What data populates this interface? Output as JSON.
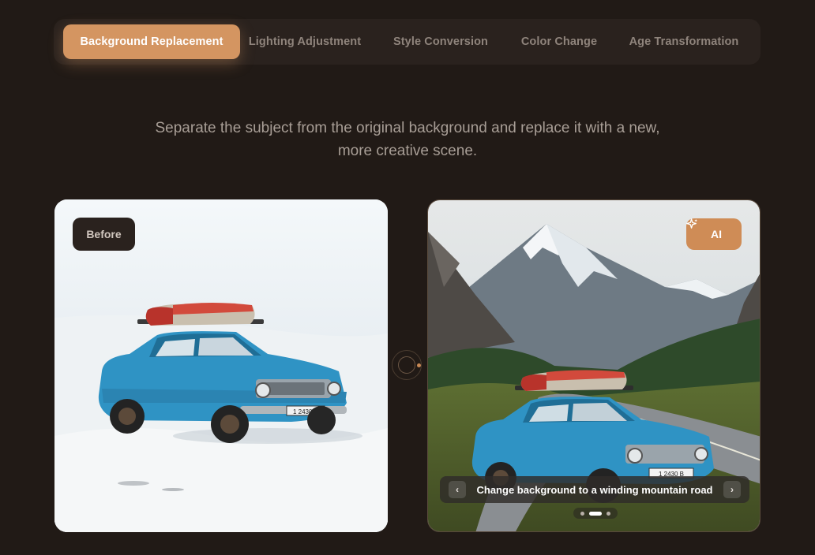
{
  "tabs": [
    {
      "label": "Background Replacement",
      "active": true
    },
    {
      "label": "Lighting Adjustment",
      "active": false
    },
    {
      "label": "Style Conversion",
      "active": false
    },
    {
      "label": "Color Change",
      "active": false
    },
    {
      "label": "Age Transformation",
      "active": false
    }
  ],
  "description": {
    "line1": "Separate the subject from the original background and replace it with a new,",
    "line2": "more creative scene."
  },
  "before_card": {
    "badge": "Before",
    "plate": "1 2430 B"
  },
  "after_card": {
    "badge": "AI",
    "badge_icon": "sparkles-icon",
    "caption": "Change background to a winding mountain road",
    "prev_icon": "chevron-left-icon",
    "next_icon": "chevron-right-icon",
    "slides_total": 3,
    "slide_active": 2,
    "plate": "1 2430 B"
  },
  "colors": {
    "page_bg": "#211a16",
    "accent": "#d49561",
    "car_blue": "#2f93c4"
  }
}
